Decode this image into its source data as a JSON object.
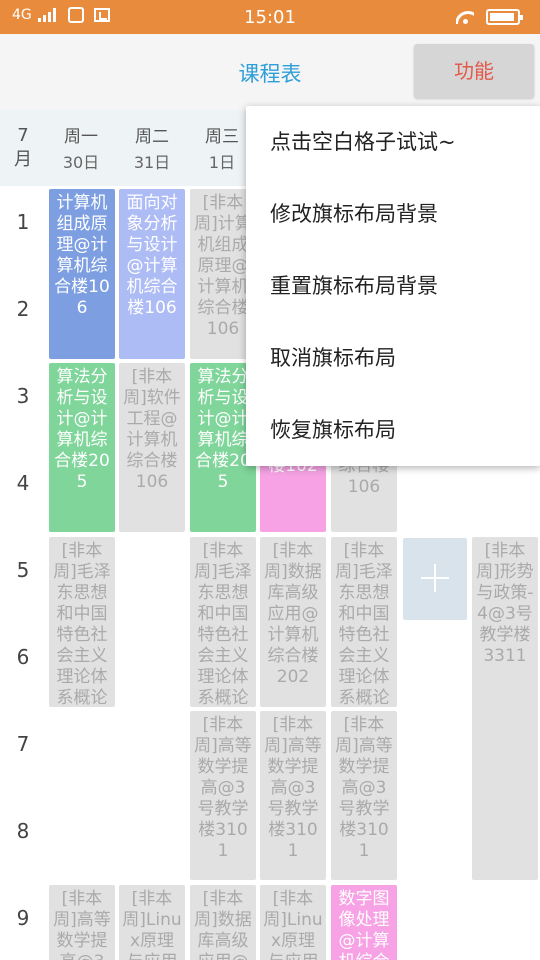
{
  "status_bar": {
    "network": "4G",
    "time": "15:01"
  },
  "header": {
    "title": "课程表",
    "function_button": "功能"
  },
  "week": {
    "month": [
      "7",
      "月"
    ],
    "days": [
      {
        "name": "周一",
        "date": "30日"
      },
      {
        "name": "周二",
        "date": "31日"
      },
      {
        "name": "周三",
        "date": "1日"
      }
    ]
  },
  "periods": [
    "1",
    "2",
    "3",
    "4",
    "5",
    "6",
    "7",
    "8",
    "9"
  ],
  "courses": [
    {
      "text": "计算机组成原理@计算机综合楼106",
      "color": "#7d9fe2"
    },
    {
      "text": "面向对象分析与设计@计算机综合楼106",
      "color": "#aebcf5"
    },
    {
      "text": "[非本周]计算机组成原理@计算机综合楼106",
      "color": "#e1e1e1"
    },
    {
      "text": "算法分析与设计@计算机综合楼205",
      "color": "#7fd59a"
    },
    {
      "text": "[非本周]软件工程@计算机综合楼106",
      "color": "#e1e1e1"
    },
    {
      "text": "算法分析与设计@计算机综合楼205",
      "color": "#7fd59a"
    },
    {
      "text": "楼102",
      "color": "#f6a2e4"
    },
    {
      "text": "综合楼106",
      "color": "#e1e1e1"
    },
    {
      "text": "[非本周]毛泽东思想和中国特色社会主义理论体系概论",
      "color": "#e1e1e1"
    },
    {
      "text": "[非本周]毛泽东思想和中国特色社会主义理论体系概论",
      "color": "#e1e1e1"
    },
    {
      "text": "[非本周]数据库高级应用@计算机综合楼202",
      "color": "#e1e1e1"
    },
    {
      "text": "[非本周]毛泽东思想和中国特色社会主义理论体系概论",
      "color": "#e1e1e1"
    },
    {
      "text": "[非本周]形势与政策-4@3号教学楼3311",
      "color": "#e1e1e1"
    },
    {
      "text": "[非本周]高等数学提高@3号教学楼3101",
      "color": "#e1e1e1"
    },
    {
      "text": "[非本周]高等数学提高@3号教学楼3101",
      "color": "#e1e1e1"
    },
    {
      "text": "[非本周]高等数学提高@3号教学楼3101",
      "color": "#e1e1e1"
    },
    {
      "text": "[非本周]高等数学提高@3号",
      "color": "#e1e1e1"
    },
    {
      "text": "[非本周]Linux原理与应用",
      "color": "#e1e1e1"
    },
    {
      "text": "[非本周]数据库高级应用@",
      "color": "#e1e1e1"
    },
    {
      "text": "[非本周]Linux原理与应用",
      "color": "#e1e1e1"
    },
    {
      "text": "数字图像处理@计算机综合",
      "color": "#f6a2e4"
    }
  ],
  "menu": {
    "items": [
      "点击空白格子试试~",
      "修改旗标布局背景",
      "重置旗标布局背景",
      "取消旗标布局",
      "恢复旗标布局"
    ]
  }
}
